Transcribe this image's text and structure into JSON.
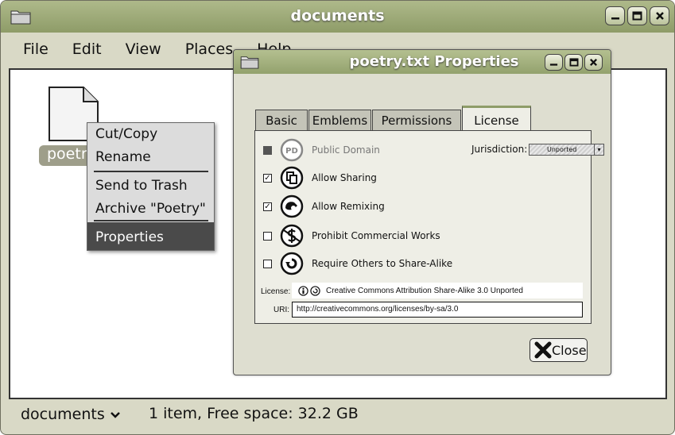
{
  "window": {
    "title": "documents",
    "buttons": [
      "–",
      "□",
      "×"
    ]
  },
  "menubar": [
    "File",
    "Edit",
    "View",
    "Places",
    "Help"
  ],
  "file": {
    "label": "poetry.txt"
  },
  "context_menu": {
    "items": [
      "Cut/Copy",
      "Rename",
      "Send to Trash",
      "Archive \"Poetry\"",
      "Properties"
    ],
    "selected": "Properties"
  },
  "statusbar": {
    "path": "documents",
    "info": "1 item, Free space: 32.2 GB"
  },
  "dialog": {
    "title": "poetry.txt Properties",
    "tabs": [
      "Basic",
      "Emblems",
      "Permissions",
      "License"
    ],
    "active_tab": "License",
    "jurisdiction_label": "Jurisdiction:",
    "jurisdiction_value": "Unported",
    "options": [
      {
        "label": "Public Domain",
        "checked": false,
        "disabled": true,
        "icon": "public-domain-icon",
        "icon_text": "PD"
      },
      {
        "label": "Allow Sharing",
        "checked": true,
        "disabled": false,
        "icon": "share-icon"
      },
      {
        "label": "Allow Remixing",
        "checked": true,
        "disabled": false,
        "icon": "remix-icon"
      },
      {
        "label": "Prohibit Commercial Works",
        "checked": false,
        "disabled": false,
        "icon": "noncommercial-icon"
      },
      {
        "label": "Require Others to Share-Alike",
        "checked": false,
        "disabled": false,
        "icon": "share-alike-icon"
      }
    ],
    "license_label": "License:",
    "license_value": "Creative Commons Attribution Share-Alike 3.0 Unported",
    "uri_label": "URI:",
    "uri_value": "http://creativecommons.org/licenses/by-sa/3.0",
    "close_label": "Close"
  },
  "colors": {
    "titlebar": "#9aa874",
    "window_bg": "#d9d9c6",
    "selection": "#4a4a4a"
  }
}
